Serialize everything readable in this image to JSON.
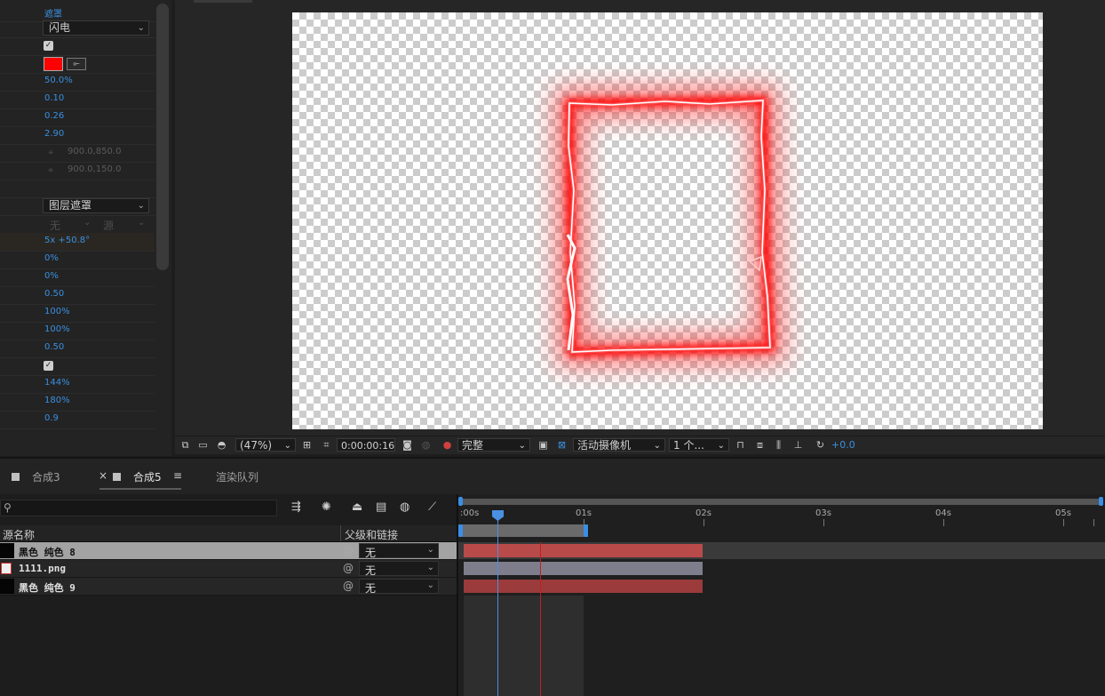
{
  "effect_controls": {
    "rows": [
      {
        "value": "遮罩",
        "kind": "text"
      },
      {
        "value": "闪电",
        "kind": "dropdown"
      },
      {
        "value": "",
        "kind": "checkbox",
        "checked": true
      },
      {
        "value": "",
        "kind": "color",
        "color": "#ff0000"
      },
      {
        "value": "50.0%",
        "kind": "text"
      },
      {
        "value": "0.10",
        "kind": "text"
      },
      {
        "value": "0.26",
        "kind": "text"
      },
      {
        "value": "2.90",
        "kind": "text"
      },
      {
        "value": "900.0,850.0",
        "kind": "point"
      },
      {
        "value": "900.0,150.0",
        "kind": "point"
      },
      {
        "value": "",
        "kind": "blank"
      },
      {
        "value": "图层遮罩",
        "kind": "dropdown"
      },
      {
        "value": "无",
        "value2": "源",
        "kind": "dual"
      },
      {
        "value": "5x +50.8°",
        "kind": "text"
      },
      {
        "value": "0%",
        "kind": "text"
      },
      {
        "value": "0%",
        "kind": "text"
      },
      {
        "value": "0.50",
        "kind": "text"
      },
      {
        "value": "100%",
        "kind": "text"
      },
      {
        "value": "100%",
        "kind": "text"
      },
      {
        "value": "0.50",
        "kind": "text"
      },
      {
        "value": "",
        "kind": "checkbox",
        "checked": true
      },
      {
        "value": "144%",
        "kind": "text"
      },
      {
        "value": "180%",
        "kind": "text"
      },
      {
        "value": "0.9",
        "kind": "text"
      }
    ]
  },
  "viewer_toolbar": {
    "zoom": "(47%)",
    "timecode": "0:00:00:16",
    "resolution": "完整",
    "camera": "活动摄像机",
    "views": "1 个...",
    "exposure": "+0.0"
  },
  "timeline": {
    "tabs": [
      {
        "label": "合成3",
        "close": ""
      },
      {
        "label": "合成5",
        "close": "×",
        "menu": "≡"
      },
      {
        "label": "渲染队列"
      }
    ],
    "col_source": "源名称",
    "col_parent": "父级和链接",
    "layers": [
      {
        "name": "黑色 纯色 8",
        "parent": "无",
        "bar_color": "#b94a4a",
        "selected": true
      },
      {
        "name": "1111.png",
        "parent": "无",
        "bar_color": "#7d7d8c",
        "selected": false
      },
      {
        "name": "黑色 纯色 9",
        "parent": "无",
        "bar_color": "#9b3b3b",
        "selected": false
      }
    ],
    "ruler": [
      ":00s",
      "01s",
      "02s",
      "03s",
      "04s",
      "05s"
    ]
  },
  "colors": {
    "accent_blue": "#3a8fe0",
    "frame_red": "#ff1010"
  }
}
